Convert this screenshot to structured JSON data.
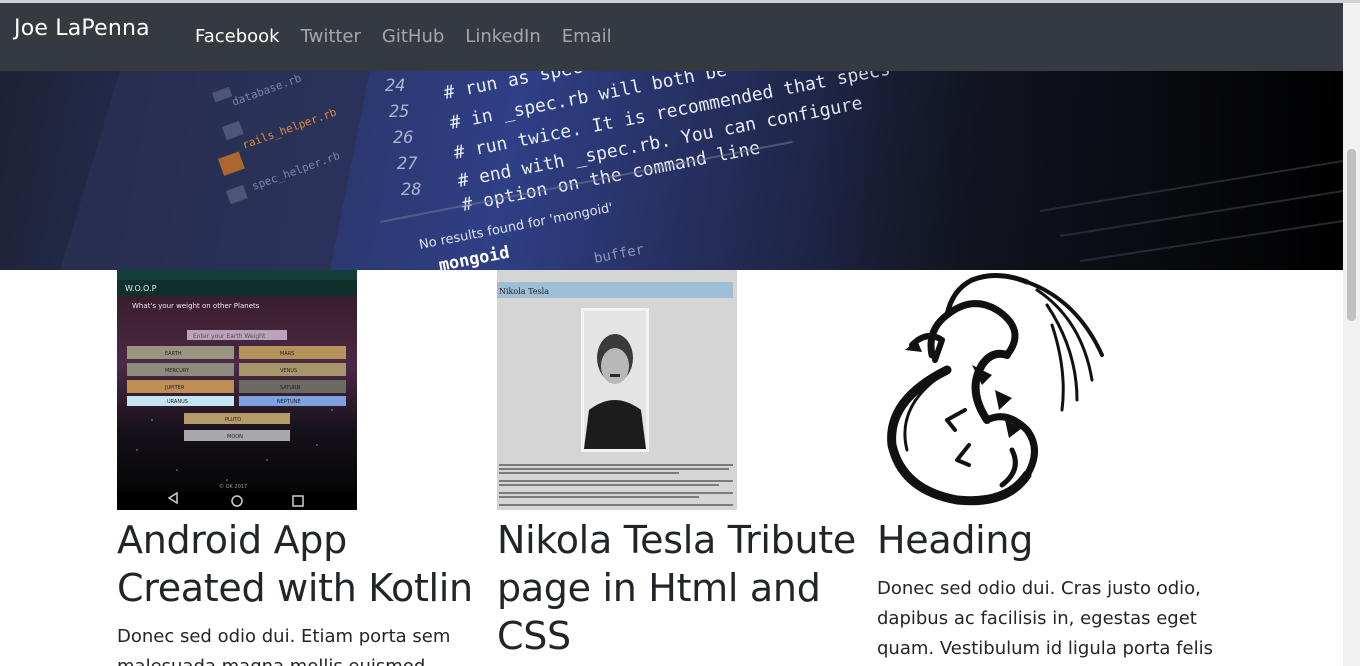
{
  "navbar": {
    "brand": "Joe LaPenna",
    "links": [
      {
        "label": "Facebook",
        "active": true
      },
      {
        "label": "Twitter",
        "active": false
      },
      {
        "label": "GitHub",
        "active": false
      },
      {
        "label": "LinkedIn",
        "active": false
      },
      {
        "label": "Email",
        "active": false
      }
    ]
  },
  "hero": {
    "code_line_numbers": [
      "24",
      "25",
      "26",
      "27",
      "28"
    ],
    "code_lines": [
      "# run as spec",
      "# in _spec.rb will both be",
      "# run twice. It is recommended that specs",
      "# end with _spec.rb. You can configure",
      "# option on the command line"
    ],
    "search_text": "No results found for 'mongoid'",
    "bottom_text": "mongoid",
    "buffer_text": "buffer",
    "file_names": [
      "database.rb",
      "rails_helper.rb",
      "spec_helper.rb"
    ]
  },
  "cards": [
    {
      "title": "Android App Created with Kotlin",
      "text": "Donec sed odio dui. Etiam porta sem malesuada magna mollis euismod.",
      "image": {
        "app_title": "W.O.O.P",
        "question": "What's your weight on other Planets",
        "input_hint": "Enter your Earth Weight",
        "planets": [
          "MARS",
          "VENUS",
          "MERCURY",
          "SATURN",
          "JUPITER",
          "EARTH",
          "URANUS",
          "NEPTUNE",
          "PLUTO",
          "MOON"
        ],
        "footer": "© OK 2017"
      }
    },
    {
      "title": "Nikola Tesla Tribute page in Html and CSS",
      "text": "",
      "image": {
        "page_title": "Nikola Tesla"
      }
    },
    {
      "title": "Heading",
      "text": "Donec sed odio dui. Cras justo odio, dapibus ac facilisis in, egestas eget quam. Vestibulum id ligula porta felis",
      "image": {}
    }
  ],
  "colors": {
    "navbar_bg": "#343a40",
    "nav_active": "#ffffff",
    "nav_inactive": "rgba(255,255,255,0.55)"
  }
}
